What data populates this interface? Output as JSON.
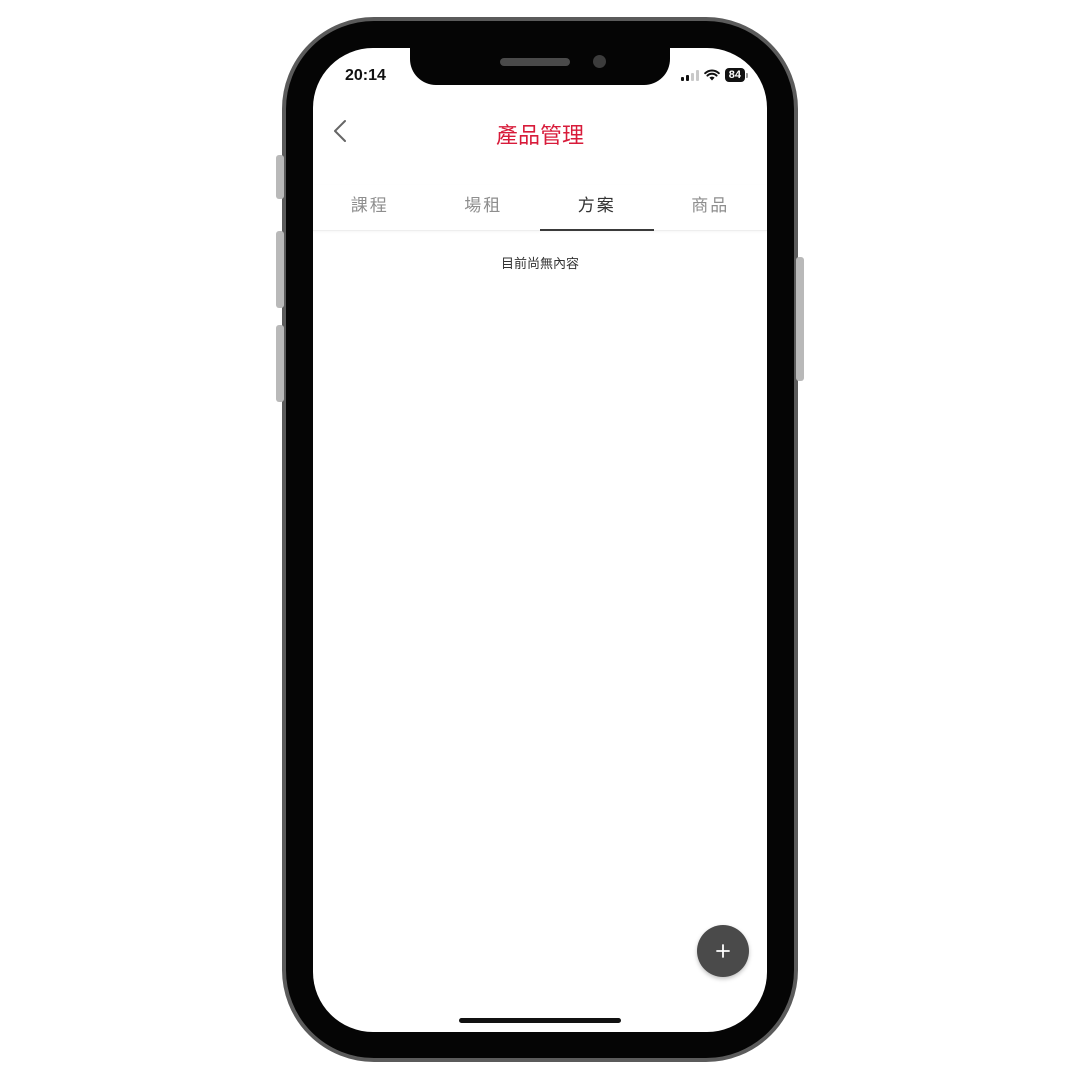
{
  "status_bar": {
    "time": "20:14",
    "battery": "84",
    "icons": [
      "signal-icon",
      "wifi-icon",
      "battery-icon"
    ]
  },
  "nav": {
    "title": "產品管理",
    "back_icon": "chevron-left-icon"
  },
  "tabs": [
    {
      "label": "課程",
      "active": false
    },
    {
      "label": "場租",
      "active": false
    },
    {
      "label": "方案",
      "active": true
    },
    {
      "label": "商品",
      "active": false
    }
  ],
  "content": {
    "empty_message": "目前尚無內容"
  },
  "fab": {
    "icon": "plus-icon"
  },
  "colors": {
    "title": "#d81b3a",
    "fab": "#4a4a4a",
    "tab_inactive": "#8e8e8e",
    "tab_active": "#333333"
  }
}
